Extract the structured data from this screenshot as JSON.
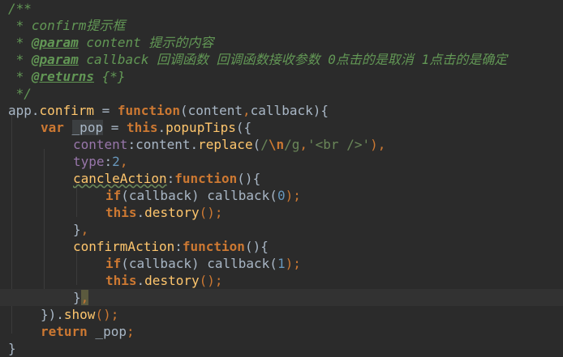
{
  "editor": {
    "lines": [
      {
        "tokens": [
          {
            "t": "/**",
            "c": "doc"
          }
        ]
      },
      {
        "tokens": [
          {
            "t": " * confirm提示框",
            "c": "doc"
          }
        ]
      },
      {
        "tokens": [
          {
            "t": " * ",
            "c": "doc"
          },
          {
            "t": "@param",
            "c": "tag"
          },
          {
            "t": " content ",
            "c": "doc"
          },
          {
            "t": "提示的内容",
            "c": "doc"
          }
        ]
      },
      {
        "tokens": [
          {
            "t": " * ",
            "c": "doc"
          },
          {
            "t": "@param",
            "c": "tag"
          },
          {
            "t": " callback ",
            "c": "doc"
          },
          {
            "t": "回调函数 回调函数接收参数 0点击的是取消 1点击的是确定",
            "c": "doc"
          }
        ]
      },
      {
        "tokens": [
          {
            "t": " * ",
            "c": "doc"
          },
          {
            "t": "@returns",
            "c": "tag"
          },
          {
            "t": " {*}",
            "c": "doc"
          }
        ]
      },
      {
        "tokens": [
          {
            "t": " */",
            "c": "doc"
          }
        ]
      },
      {
        "tokens": [
          {
            "t": "app",
            "c": "plain"
          },
          {
            "t": ".",
            "c": "plain"
          },
          {
            "t": "confirm",
            "c": "fn"
          },
          {
            "t": " = ",
            "c": "plain"
          },
          {
            "t": "function",
            "c": "kw"
          },
          {
            "t": "(content",
            "c": "plain"
          },
          {
            "t": ",",
            "c": "punct"
          },
          {
            "t": "callback){",
            "c": "plain"
          }
        ]
      },
      {
        "indent": 1,
        "tokens": [
          {
            "t": "var",
            "c": "kw"
          },
          {
            "t": " ",
            "c": "plain"
          },
          {
            "t": "_pop",
            "c": "plain highlight-var"
          },
          {
            "t": " = ",
            "c": "plain"
          },
          {
            "t": "this",
            "c": "kw"
          },
          {
            "t": ".",
            "c": "plain"
          },
          {
            "t": "popupTips",
            "c": "fn"
          },
          {
            "t": "({",
            "c": "plain"
          }
        ]
      },
      {
        "indent": 2,
        "tokens": [
          {
            "t": "content",
            "c": "prop"
          },
          {
            "t": ":content.",
            "c": "plain"
          },
          {
            "t": "replace",
            "c": "fn"
          },
          {
            "t": "(",
            "c": "plain"
          },
          {
            "t": "/",
            "c": "regex"
          },
          {
            "t": "\\n",
            "c": "esc"
          },
          {
            "t": "/g",
            "c": "regex"
          },
          {
            "t": ",",
            "c": "punct"
          },
          {
            "t": "'<br />'",
            "c": "str"
          },
          {
            "t": "),",
            "c": "punct"
          }
        ]
      },
      {
        "indent": 2,
        "tokens": [
          {
            "t": "type",
            "c": "prop"
          },
          {
            "t": ":",
            "c": "plain"
          },
          {
            "t": "2",
            "c": "num"
          },
          {
            "t": ",",
            "c": "punct"
          }
        ]
      },
      {
        "indent": 2,
        "tokens": [
          {
            "t": "cancleAction",
            "c": "fn squiggle"
          },
          {
            "t": ":",
            "c": "plain"
          },
          {
            "t": "function",
            "c": "kw"
          },
          {
            "t": "(){",
            "c": "plain"
          }
        ]
      },
      {
        "indent": 3,
        "tokens": [
          {
            "t": "if",
            "c": "kw"
          },
          {
            "t": "(callback) ",
            "c": "plain"
          },
          {
            "t": "callback",
            "c": "plain"
          },
          {
            "t": "(",
            "c": "plain"
          },
          {
            "t": "0",
            "c": "num"
          },
          {
            "t": ");",
            "c": "punct"
          }
        ]
      },
      {
        "indent": 3,
        "tokens": [
          {
            "t": "this",
            "c": "kw"
          },
          {
            "t": ".",
            "c": "plain"
          },
          {
            "t": "destory",
            "c": "fn"
          },
          {
            "t": "();",
            "c": "punct"
          }
        ]
      },
      {
        "indent": 2,
        "tokens": [
          {
            "t": "}",
            "c": "plain"
          },
          {
            "t": ",",
            "c": "punct"
          }
        ]
      },
      {
        "indent": 2,
        "tokens": [
          {
            "t": "confirmAction",
            "c": "fn"
          },
          {
            "t": ":",
            "c": "plain"
          },
          {
            "t": "function",
            "c": "kw"
          },
          {
            "t": "(){",
            "c": "plain"
          }
        ]
      },
      {
        "indent": 3,
        "tokens": [
          {
            "t": "if",
            "c": "kw"
          },
          {
            "t": "(callback) ",
            "c": "plain"
          },
          {
            "t": "callback",
            "c": "plain"
          },
          {
            "t": "(",
            "c": "plain"
          },
          {
            "t": "1",
            "c": "num"
          },
          {
            "t": ");",
            "c": "punct"
          }
        ]
      },
      {
        "indent": 3,
        "tokens": [
          {
            "t": "this",
            "c": "kw"
          },
          {
            "t": ".",
            "c": "plain"
          },
          {
            "t": "destory",
            "c": "fn"
          },
          {
            "t": "();",
            "c": "punct"
          }
        ]
      },
      {
        "indent": 2,
        "current": true,
        "tokens": [
          {
            "t": "}",
            "c": "plain"
          },
          {
            "t": ",",
            "c": "punct cursor-block"
          }
        ]
      },
      {
        "indent": 1,
        "tokens": [
          {
            "t": "}).",
            "c": "plain"
          },
          {
            "t": "show",
            "c": "fn"
          },
          {
            "t": "();",
            "c": "punct"
          }
        ]
      },
      {
        "indent": 1,
        "tokens": [
          {
            "t": "return",
            "c": "kw"
          },
          {
            "t": " _pop",
            "c": "plain"
          },
          {
            "t": ";",
            "c": "punct"
          }
        ]
      },
      {
        "tokens": [
          {
            "t": "}",
            "c": "plain"
          }
        ]
      }
    ]
  }
}
